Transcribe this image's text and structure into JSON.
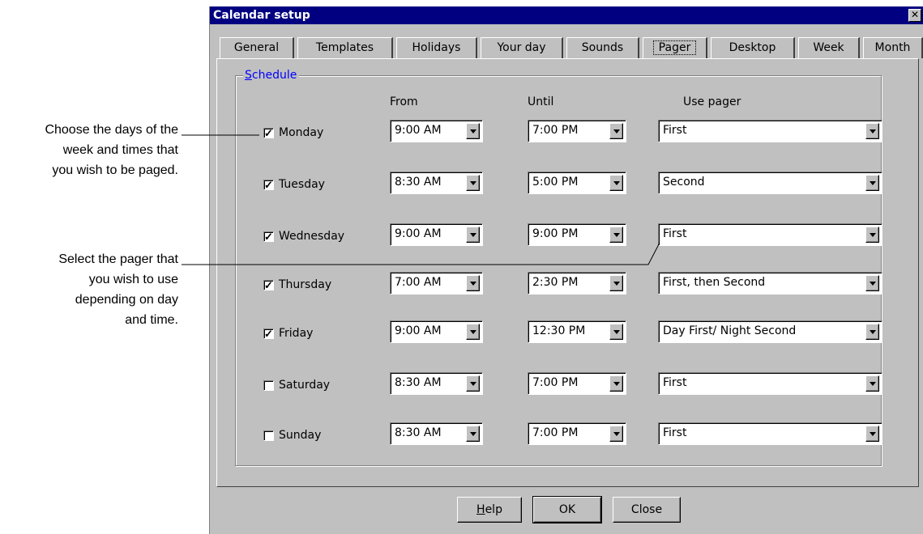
{
  "annotations": {
    "days_times": [
      "Choose the days of the",
      "week and times that",
      "you wish to be paged."
    ],
    "pager": [
      "Select the pager that",
      "you wish to use",
      "depending on day",
      "and time."
    ]
  },
  "window": {
    "title": "Calendar setup",
    "close_label": "✕"
  },
  "tabs": [
    {
      "label": "General"
    },
    {
      "label": "Templates"
    },
    {
      "label": "Holidays"
    },
    {
      "label": "Your day"
    },
    {
      "label": "Sounds"
    },
    {
      "label": "Pager"
    },
    {
      "label": "Desktop"
    },
    {
      "label": "Week"
    },
    {
      "label": "Month"
    }
  ],
  "active_tab": "Pager",
  "schedule": {
    "group_label": "Schedule",
    "headers": {
      "from": "From",
      "until": "Until",
      "use_pager": "Use pager"
    },
    "rows": [
      {
        "day": "Monday",
        "checked": true,
        "from": "9:00 AM",
        "until": "7:00 PM",
        "pager": "First"
      },
      {
        "day": "Tuesday",
        "checked": true,
        "from": "8:30 AM",
        "until": "5:00 PM",
        "pager": "Second"
      },
      {
        "day": "Wednesday",
        "checked": true,
        "from": "9:00 AM",
        "until": "9:00 PM",
        "pager": "First"
      },
      {
        "day": "Thursday",
        "checked": true,
        "from": "7:00 AM",
        "until": "2:30 PM",
        "pager": "First, then Second"
      },
      {
        "day": "Friday",
        "checked": true,
        "from": "9:00 AM",
        "until": "12:30 PM",
        "pager": "Day First/ Night Second"
      },
      {
        "day": "Saturday",
        "checked": false,
        "from": "8:30 AM",
        "until": "7:00 PM",
        "pager": "First"
      },
      {
        "day": "Sunday",
        "checked": false,
        "from": "8:30 AM",
        "until": "7:00 PM",
        "pager": "First"
      }
    ]
  },
  "buttons": {
    "help": "Help",
    "ok": "OK",
    "close": "Close"
  }
}
